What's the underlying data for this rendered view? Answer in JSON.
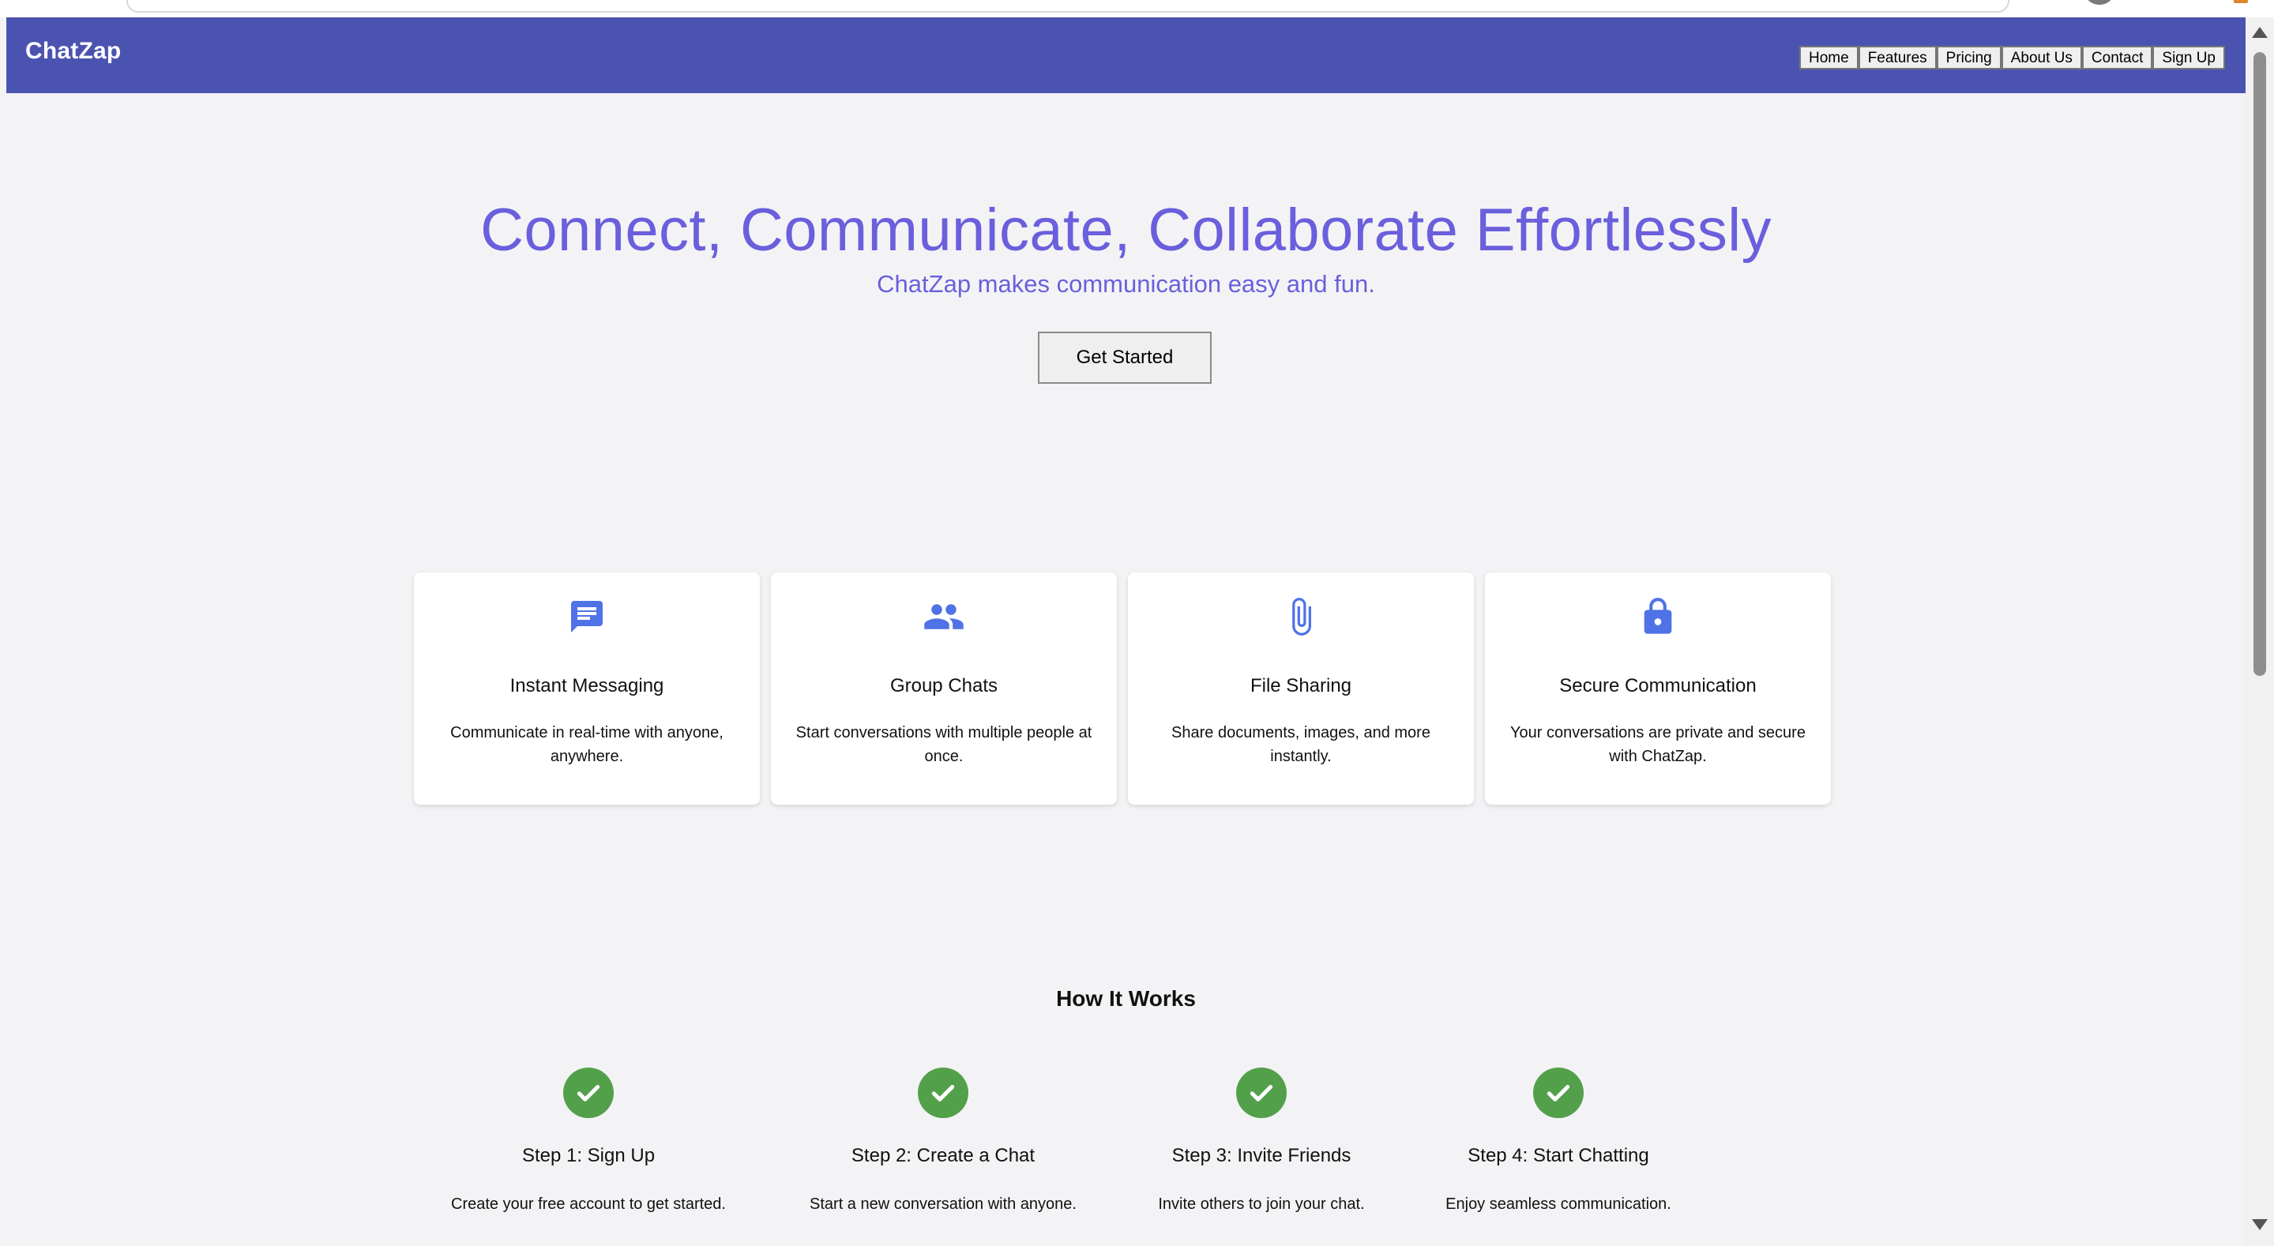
{
  "header": {
    "brand": "ChatZap",
    "nav": [
      "Home",
      "Features",
      "Pricing",
      "About Us",
      "Contact",
      "Sign Up"
    ]
  },
  "hero": {
    "title": "Connect, Communicate, Collaborate Effortlessly",
    "subtitle": "ChatZap makes communication easy and fun.",
    "cta_label": "Get Started"
  },
  "features": [
    {
      "icon": "chat-bubble-icon",
      "title": "Instant Messaging",
      "description": "Communicate in real-time with anyone, anywhere."
    },
    {
      "icon": "group-icon",
      "title": "Group Chats",
      "description": "Start conversations with multiple people at once."
    },
    {
      "icon": "paperclip-icon",
      "title": "File Sharing",
      "description": "Share documents, images, and more instantly."
    },
    {
      "icon": "lock-icon",
      "title": "Secure Communication",
      "description": "Your conversations are private and secure with ChatZap."
    }
  ],
  "how_it_works": {
    "title": "How It Works",
    "steps": [
      {
        "title": "Step 1: Sign Up",
        "description": "Create your free account to get started."
      },
      {
        "title": "Step 2: Create a Chat",
        "description": "Start a new conversation with anyone."
      },
      {
        "title": "Step 3: Invite Friends",
        "description": "Invite others to join your chat."
      },
      {
        "title": "Step 4: Start Chatting",
        "description": "Enjoy seamless communication."
      }
    ]
  },
  "colors": {
    "header_bg": "#4b53b0",
    "hero_text": "#6a5fdc",
    "feature_icon": "#4f72e6",
    "step_icon": "#53a04a"
  }
}
